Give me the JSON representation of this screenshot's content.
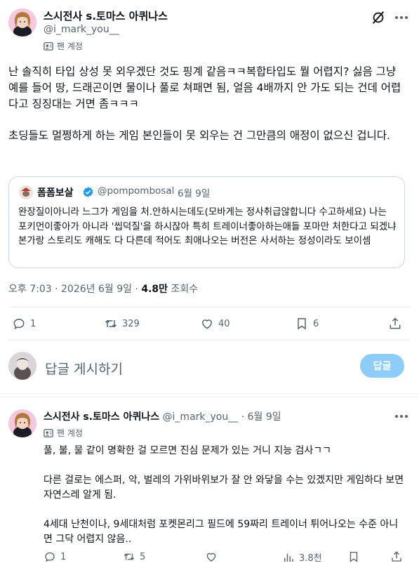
{
  "post": {
    "display_name": "스시전사 s.토마스 아퀴나스",
    "handle": "@i_mark_you__",
    "account_badge": "팬 계정",
    "paragraph_1": "난 솔직히 타입 상성 못 외우겠단 것도 핑계 같음ㅋㅋ복합타입도 뭘 어렵지? 싫음 그냥 예를 들어 땅, 드래곤이면 물이나 풀로 쳐패면 됨, 얼음 4배까지 안 가도 되는 건데 어렵다고 징징대는 거면 좀ㅋㅋㅋ",
    "paragraph_2": "초딩들도 멀쩡하게 하는 게임 본인들이 못 외우는 건 그만큼의 애정이 없으신 겁니다.",
    "timestamp": "오후 7:03 · 2026년 6월 9일 · ",
    "views_count": "4.8만",
    "views_label": " 조회수",
    "actions": {
      "replies": "1",
      "reposts": "329",
      "likes": "40",
      "bookmarks": "6"
    }
  },
  "quote": {
    "display_name": "폼폼보살",
    "handle": "@pompombosal",
    "separator": "·",
    "date": "6월 9일",
    "text": "완장질이아니라 느그가 게임을 처.안하시는데도(모바게는 정사취급않합니다 수고하세요) 나는 포키먼이좋아가 아니라 '씹덕질'을 하시잖아 특히 트레이너좋아하는애들 포마만 처한다고 되겠냐 본가랑 스토리도 캐해도 다 다른데 적어도 최애나오는 버전은 사서하는 정성이라도 보이셈"
  },
  "compose": {
    "placeholder": "답글 게시하기",
    "reply_button": "답글"
  },
  "reply": {
    "display_name": "스시전사 s.토마스 아퀴나스",
    "handle": "@i_mark_you__",
    "separator": "·",
    "date": "6월 9일",
    "account_badge": "팬 계정",
    "paragraph_1": "풀, 불, 물 같이 명확한 걸 모르면 진심 문제가 있는 거니 지능 검사ㄱㄱ",
    "paragraph_2": "다른 걸로는 에스퍼, 악, 벌레의 가위바위보가 잘 안 와닿을 수는 있겠지만 게임하다 보면 자연스레 알게 됨.",
    "paragraph_3": "4세대 난천이나, 9세대처럼 포켓몬리그 필드에 59짜리 트레이너 튀어나오는 수준 아니면 그닥 어렵지 않음..",
    "actions": {
      "replies": "1",
      "reposts": "5",
      "likes": "",
      "views": "3.8천"
    }
  },
  "colors": {
    "accent": "#1d9bf0",
    "reply_button_disabled": "#8ecdf8",
    "muted_text": "#536471",
    "border": "#cfd9de"
  },
  "icons": [
    "grok-icon",
    "more-icon",
    "fan-account-icon",
    "verified-icon",
    "reply-icon",
    "repost-icon",
    "like-icon",
    "bookmark-icon",
    "share-icon",
    "views-icon"
  ]
}
